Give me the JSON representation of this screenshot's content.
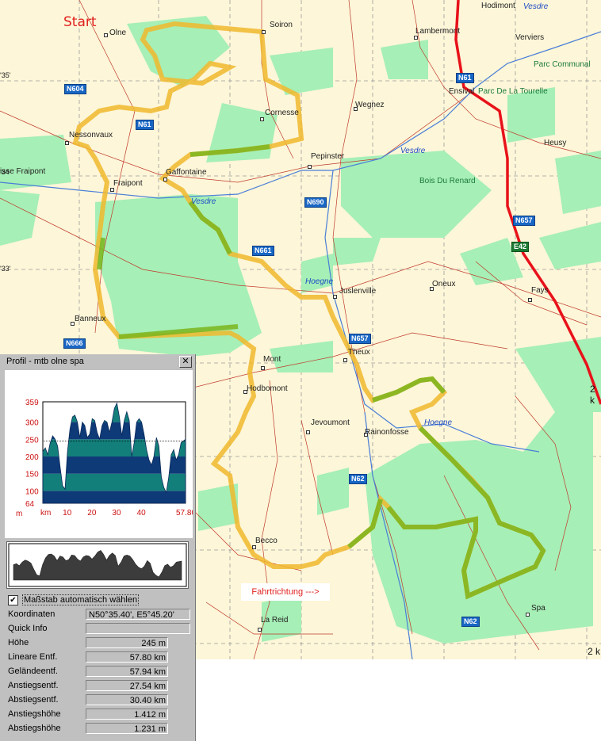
{
  "map": {
    "start_label": "Start",
    "direction_label": "Fahrtrichtung --->",
    "scale_label_1": "2 k",
    "scale_label_2": "2 k",
    "coord_labels": [
      "'35'",
      "'34",
      "'33'"
    ],
    "places": [
      "Olne",
      "Soiron",
      "Lambermont",
      "Hodimont",
      "Verviers",
      "Parc Communal",
      "Ensival",
      "Parc De La Tourelle",
      "Wegnez",
      "Cornesse",
      "Nessonvaux",
      "Fraipont",
      "Gaffontaine",
      "Pepinster",
      "Bois Du Renard",
      "Heusy",
      "Juslenville",
      "Oneux",
      "Fays",
      "Banneux",
      "Mont",
      "Theux",
      "Hodbomont",
      "Jevoumont",
      "Rainonfosse",
      "Becco",
      "La Reid",
      "Spa",
      "isse Fraipont"
    ],
    "water": [
      "Vesdre",
      "Vesdre",
      "Vesdre",
      "Hoegne",
      "Hoegne"
    ],
    "roads": [
      "N604",
      "N61",
      "N61",
      "N690",
      "N661",
      "N657",
      "N657",
      "N666",
      "N62",
      "N62",
      "E42"
    ],
    "colors": {
      "route": "#f0b92e",
      "route_forest": "#7ab51d",
      "highway": "#e8121a",
      "forest": "#a6efb6",
      "background": "#fdf6d8"
    }
  },
  "profile": {
    "title": "Profil - mtb olne spa",
    "close_label": "✕",
    "autoscale_label": "Maßstab automatisch wählen",
    "autoscale_checked": true,
    "rows": [
      {
        "label": "Koordinaten",
        "value": "N50°35.40', E5°45.20'"
      },
      {
        "label": "Quick Info",
        "value": ""
      },
      {
        "label": "Höhe",
        "value": "245 m"
      },
      {
        "label": "Lineare Entf.",
        "value": "57.80 km"
      },
      {
        "label": "Geländeentf.",
        "value": "57.94 km"
      },
      {
        "label": "Anstiegsentf.",
        "value": "27.54 km"
      },
      {
        "label": "Abstiegsentf.",
        "value": "30.40 km"
      },
      {
        "label": "Anstiegshöhe",
        "value": "1.412 m"
      },
      {
        "label": "Abstiegshöhe",
        "value": "1.231 m"
      }
    ]
  },
  "chart_data": {
    "type": "area",
    "title": "",
    "ylabel": "m",
    "xlabel": "km",
    "ylim": [
      64,
      359
    ],
    "xlim": [
      0,
      57.8
    ],
    "y_ticks": [
      "359",
      "300",
      "250",
      "200",
      "150",
      "100",
      "64"
    ],
    "x_ticks": [
      "10",
      "20",
      "30",
      "40",
      "57.80"
    ],
    "reference_line": 245,
    "x": [
      0,
      1,
      2,
      3,
      4,
      5,
      6,
      7,
      8,
      9,
      10,
      11,
      12,
      13,
      14,
      15,
      16,
      17,
      18,
      19,
      20,
      21,
      22,
      23,
      24,
      25,
      26,
      27,
      28,
      29,
      30,
      31,
      32,
      33,
      34,
      35,
      36,
      37,
      38,
      39,
      40,
      41,
      42,
      43,
      44,
      45,
      46,
      47,
      48,
      49,
      50,
      51,
      52,
      53,
      54,
      55,
      56,
      57.8
    ],
    "values": [
      215,
      225,
      205,
      240,
      260,
      250,
      230,
      170,
      115,
      105,
      215,
      280,
      315,
      320,
      300,
      255,
      300,
      290,
      255,
      265,
      310,
      305,
      270,
      250,
      290,
      305,
      300,
      270,
      300,
      340,
      355,
      315,
      260,
      305,
      330,
      305,
      200,
      240,
      300,
      310,
      300,
      265,
      220,
      190,
      175,
      200,
      255,
      230,
      140,
      110,
      95,
      140,
      205,
      220,
      190,
      205,
      240,
      250
    ]
  }
}
